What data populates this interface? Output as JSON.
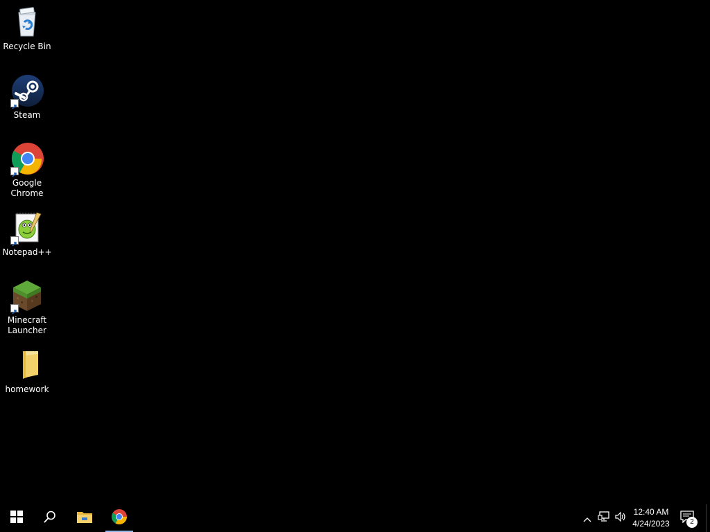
{
  "desktop": {
    "icons": [
      {
        "label": "Recycle Bin",
        "icon": "recycle-bin-icon"
      },
      {
        "label": "Steam",
        "icon": "steam-icon"
      },
      {
        "label": "Google\nChrome",
        "icon": "chrome-icon"
      },
      {
        "label": "Notepad++",
        "icon": "notepadplusplus-icon"
      },
      {
        "label": "Minecraft\nLauncher",
        "icon": "minecraft-icon"
      },
      {
        "label": "homework",
        "icon": "folder-icon"
      }
    ]
  },
  "taskbar": {
    "start": {
      "icon": "windows-logo-icon"
    },
    "search": {
      "icon": "search-icon"
    },
    "pinned": [
      {
        "name": "File Explorer",
        "icon": "file-explorer-icon",
        "active": false
      },
      {
        "name": "Google Chrome",
        "icon": "chrome-icon",
        "active": true
      }
    ],
    "tray": {
      "chevron": "chevron-up-icon",
      "network": "network-icon",
      "volume": "volume-icon",
      "time": "12:40 AM",
      "date": "4/24/2023",
      "notification_count": "2"
    }
  },
  "colors": {
    "background": "#000000",
    "taskbar": "#000000",
    "active_indicator": "#8fb6e6",
    "folder": "#f2d16b"
  }
}
